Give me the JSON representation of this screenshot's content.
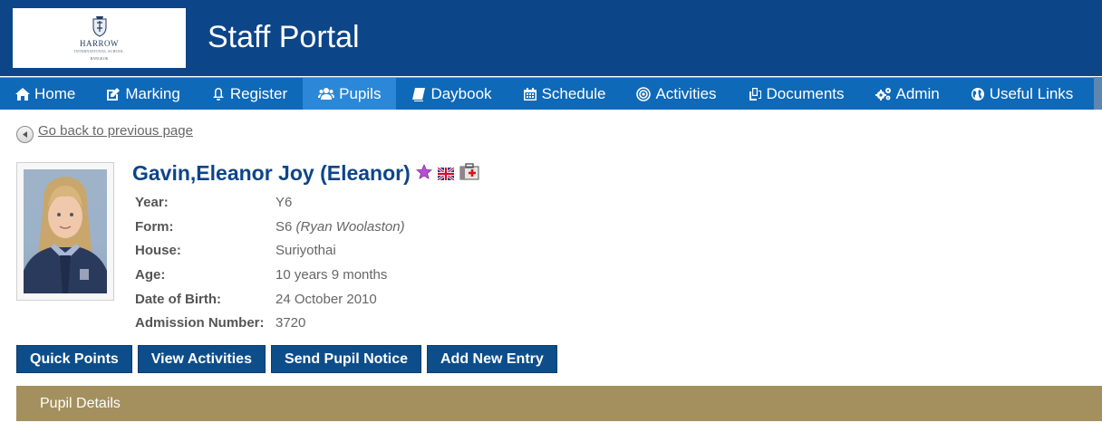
{
  "header": {
    "logo": {
      "name": "HARROW",
      "subtitle": "INTERNATIONAL SCHOOL",
      "est": "BANGKOK"
    },
    "title": "Staff Portal",
    "background": "#0d4589"
  },
  "nav": {
    "items": [
      {
        "label": "Home",
        "icon": "home-icon"
      },
      {
        "label": "Marking",
        "icon": "edit-icon"
      },
      {
        "label": "Register",
        "icon": "bell-icon"
      },
      {
        "label": "Pupils",
        "icon": "users-icon",
        "active": true
      },
      {
        "label": "Daybook",
        "icon": "book-icon"
      },
      {
        "label": "Schedule",
        "icon": "calendar-icon"
      },
      {
        "label": "Activities",
        "icon": "target-icon"
      },
      {
        "label": "Documents",
        "icon": "documents-icon"
      },
      {
        "label": "Admin",
        "icon": "gears-icon"
      },
      {
        "label": "Useful Links",
        "icon": "globe-icon"
      }
    ]
  },
  "back_link": "Go back to previous page",
  "pupil": {
    "name": "Gavin,Eleanor Joy (Eleanor)",
    "icons": [
      "star-icon",
      "uk-flag-icon",
      "medical-kit-icon"
    ],
    "details": [
      {
        "label": "Year:",
        "value": "Y6"
      },
      {
        "label": "Form:",
        "value": "S6",
        "value_extra": "(Ryan Woolaston)"
      },
      {
        "label": "House:",
        "value": "Suriyothai"
      },
      {
        "label": "Age:",
        "value": "10 years 9 months"
      },
      {
        "label": "Date of Birth:",
        "value": "24 October 2010"
      },
      {
        "label": "Admission Number:",
        "value": "3720"
      }
    ]
  },
  "actions": [
    "Quick Points",
    "View Activities",
    "Send Pupil Notice",
    "Add New Entry"
  ],
  "section": {
    "label": "Pupil Details",
    "color": "#a3905e"
  }
}
